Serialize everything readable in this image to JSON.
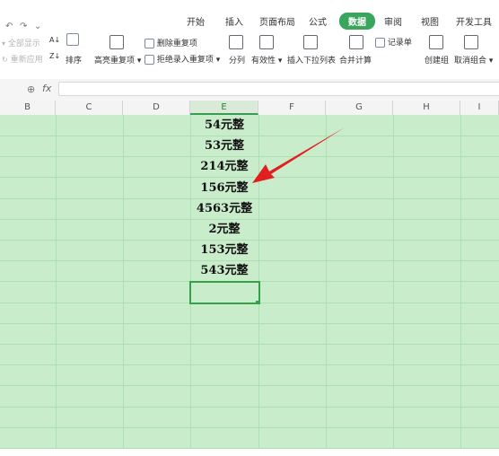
{
  "quick_access": {
    "undo": "↶",
    "redo": "↷",
    "more": "⌄"
  },
  "tabs": [
    "开始",
    "插入",
    "页面布局",
    "公式",
    "数据",
    "审阅",
    "视图",
    "开发工具"
  ],
  "active_tab": "数据",
  "toolbar": {
    "show_all": "全部显示",
    "reapply": "重新应用",
    "sort": "排序",
    "highlight_dup": "高亮重复项",
    "delete_dup": "删除重复项",
    "reject_dup": "拒绝录入重复项",
    "split": "分列",
    "validity": "有效性",
    "dropdown": "插入下拉列表",
    "merge_calc": "合并计算",
    "record_form": "记录单",
    "create_group": "创建组",
    "ungroup": "取消组合"
  },
  "formula_bar": {
    "fx": "fx",
    "value": ""
  },
  "columns": [
    "B",
    "C",
    "D",
    "E",
    "F",
    "G",
    "H",
    "I"
  ],
  "selected_column": "E",
  "cells": [
    "54元整",
    "53元整",
    "214元整",
    "156元整",
    "4563元整",
    "2元整",
    "153元整",
    "543元整"
  ],
  "colors": {
    "grid": "#c9eccb",
    "accent": "#3aa55d",
    "arrow": "#e02020"
  }
}
